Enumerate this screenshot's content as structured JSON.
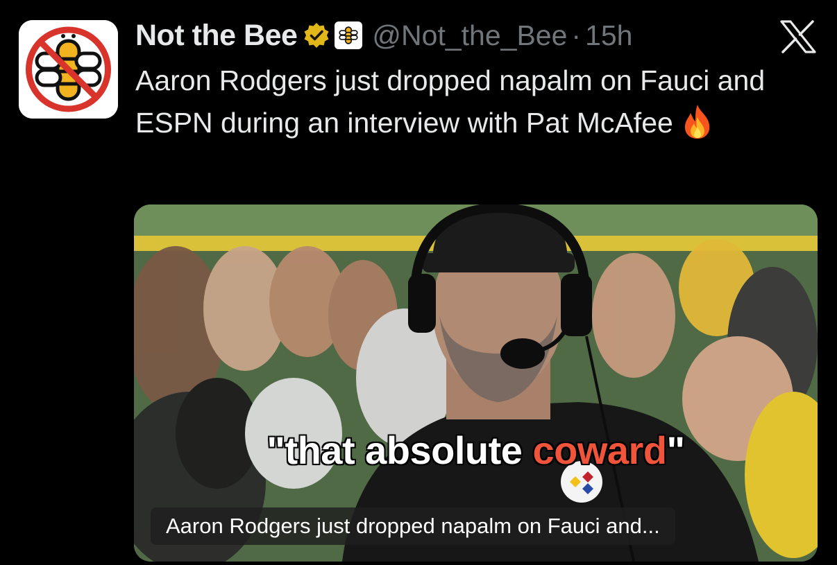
{
  "tweet": {
    "display_name": "Not the Bee",
    "handle": "@Not_the_Bee",
    "separator": "·",
    "time": "15h",
    "text": "Aaron Rodgers just dropped napalm on Fauci and ESPN during an interview with Pat McAfee",
    "emoji": "fire-emoji",
    "verified_badge": "gold-verified-icon",
    "affiliate_badge": "bee-logo-icon"
  },
  "media": {
    "quote_open": "\"that absolute ",
    "quote_highlight": "coward",
    "quote_close": "\"",
    "caption": "Aaron Rodgers just dropped napalm on Fauci and..."
  },
  "colors": {
    "background": "#000000",
    "text": "#e7e9ea",
    "muted": "#71767b",
    "verified_gold": "#e2b719",
    "highlight": "#f0543a"
  }
}
